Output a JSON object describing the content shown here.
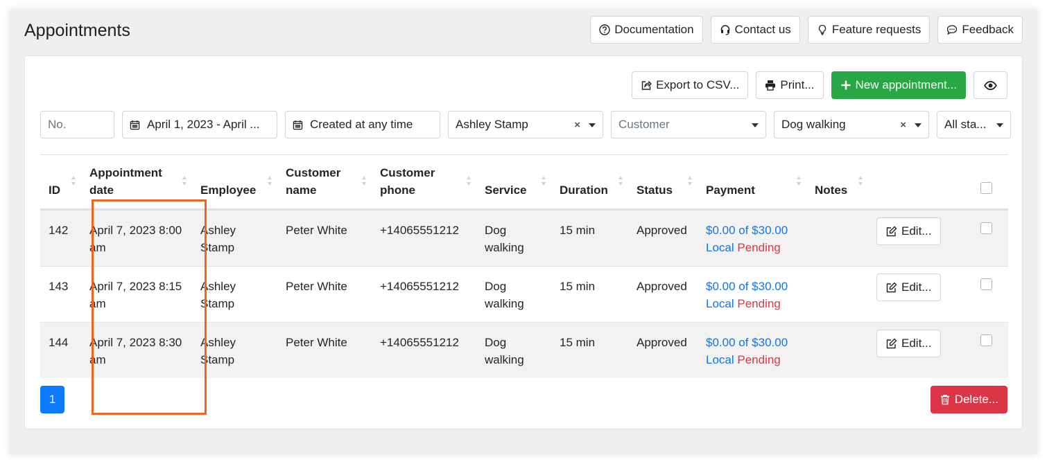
{
  "page": {
    "title": "Appointments"
  },
  "top_buttons": [
    {
      "label": "Documentation",
      "icon": "question-circle-icon"
    },
    {
      "label": "Contact us",
      "icon": "headset-icon"
    },
    {
      "label": "Feature requests",
      "icon": "lightbulb-icon"
    },
    {
      "label": "Feedback",
      "icon": "chat-bubble-icon"
    }
  ],
  "toolbar": {
    "export_label": "Export to CSV...",
    "print_label": "Print...",
    "new_label": "New appointment...",
    "columns_icon": "eye-icon"
  },
  "filters": {
    "number_placeholder": "No.",
    "date_range": "April 1, 2023 - April ...",
    "created": "Created at any time",
    "employee": "Ashley Stamp",
    "customer_placeholder": "Customer",
    "service": "Dog walking",
    "status": "All sta..."
  },
  "table": {
    "headers": {
      "id": "ID",
      "date_line1": "Appointment",
      "date_line2": "date",
      "employee": "Employee",
      "customer_line1": "Customer",
      "customer_line2": "name",
      "phone_line1": "Customer",
      "phone_line2": "phone",
      "service": "Service",
      "duration": "Duration",
      "status": "Status",
      "payment": "Payment",
      "notes": "Notes"
    },
    "rows": [
      {
        "id": "142",
        "date": "April 7, 2023 8:00 am",
        "employee": "Ashley Stamp",
        "customer": "Peter White",
        "phone": "+14065551212",
        "service": "Dog walking",
        "duration": "15 min",
        "status": "Approved",
        "payment_amount": "$0.00 of $30.00",
        "payment_method": "Local",
        "payment_status": "Pending",
        "notes": "",
        "edit_label": "Edit..."
      },
      {
        "id": "143",
        "date": "April 7, 2023 8:15 am",
        "employee": "Ashley Stamp",
        "customer": "Peter White",
        "phone": "+14065551212",
        "service": "Dog walking",
        "duration": "15 min",
        "status": "Approved",
        "payment_amount": "$0.00 of $30.00",
        "payment_method": "Local",
        "payment_status": "Pending",
        "notes": "",
        "edit_label": "Edit..."
      },
      {
        "id": "144",
        "date": "April 7, 2023 8:30 am",
        "employee": "Ashley Stamp",
        "customer": "Peter White",
        "phone": "+14065551212",
        "service": "Dog walking",
        "duration": "15 min",
        "status": "Approved",
        "payment_amount": "$0.00 of $30.00",
        "payment_method": "Local",
        "payment_status": "Pending",
        "notes": "",
        "edit_label": "Edit..."
      }
    ]
  },
  "pagination": {
    "current_page": "1"
  },
  "footer": {
    "delete_label": "Delete..."
  },
  "colors": {
    "accent": "#0d7bff",
    "success": "#28a745",
    "danger": "#dc3545",
    "highlight": "#f26322",
    "link": "#1275e6"
  }
}
